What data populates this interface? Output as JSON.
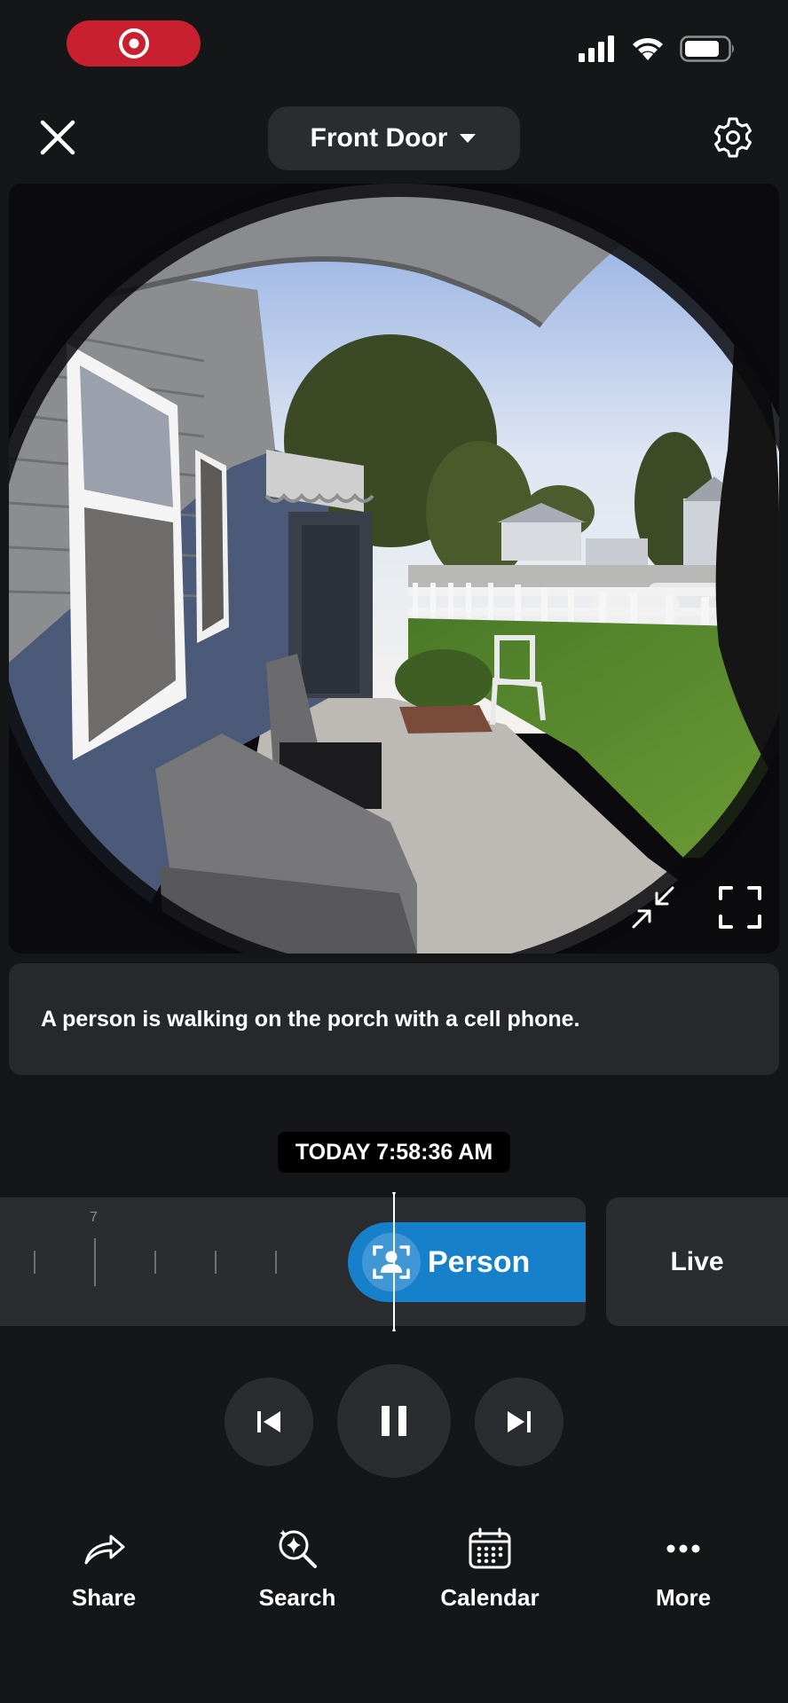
{
  "status_bar": {
    "brand_icon": "target-logo",
    "signal_icon": "cellular-signal-icon",
    "wifi_icon": "wifi-icon",
    "battery_icon": "battery-icon",
    "brand_color": "#c9202f"
  },
  "header": {
    "close_icon": "close-icon",
    "camera_name": "Front Door",
    "dropdown_icon": "caret-down-icon",
    "settings_icon": "gear-icon"
  },
  "video": {
    "exit_fullscreen_icon": "collapse-arrows-icon",
    "fullscreen_icon": "fullscreen-icon"
  },
  "event": {
    "description": "A person is walking on the porch with a cell phone.",
    "timestamp": "TODAY 7:58:36 AM"
  },
  "timeline": {
    "tick_label": "7",
    "event_label": "Person",
    "event_icon": "person-detect-icon",
    "event_color": "#1680cb",
    "live_label": "Live"
  },
  "playback": {
    "prev_icon": "skip-previous-icon",
    "pause_icon": "pause-icon",
    "next_icon": "skip-next-icon"
  },
  "bottom_nav": {
    "items": [
      {
        "label": "Share",
        "icon": "share-arrow-icon"
      },
      {
        "label": "Search",
        "icon": "sparkle-search-icon"
      },
      {
        "label": "Calendar",
        "icon": "calendar-icon"
      },
      {
        "label": "More",
        "icon": "more-dots-icon"
      }
    ]
  }
}
